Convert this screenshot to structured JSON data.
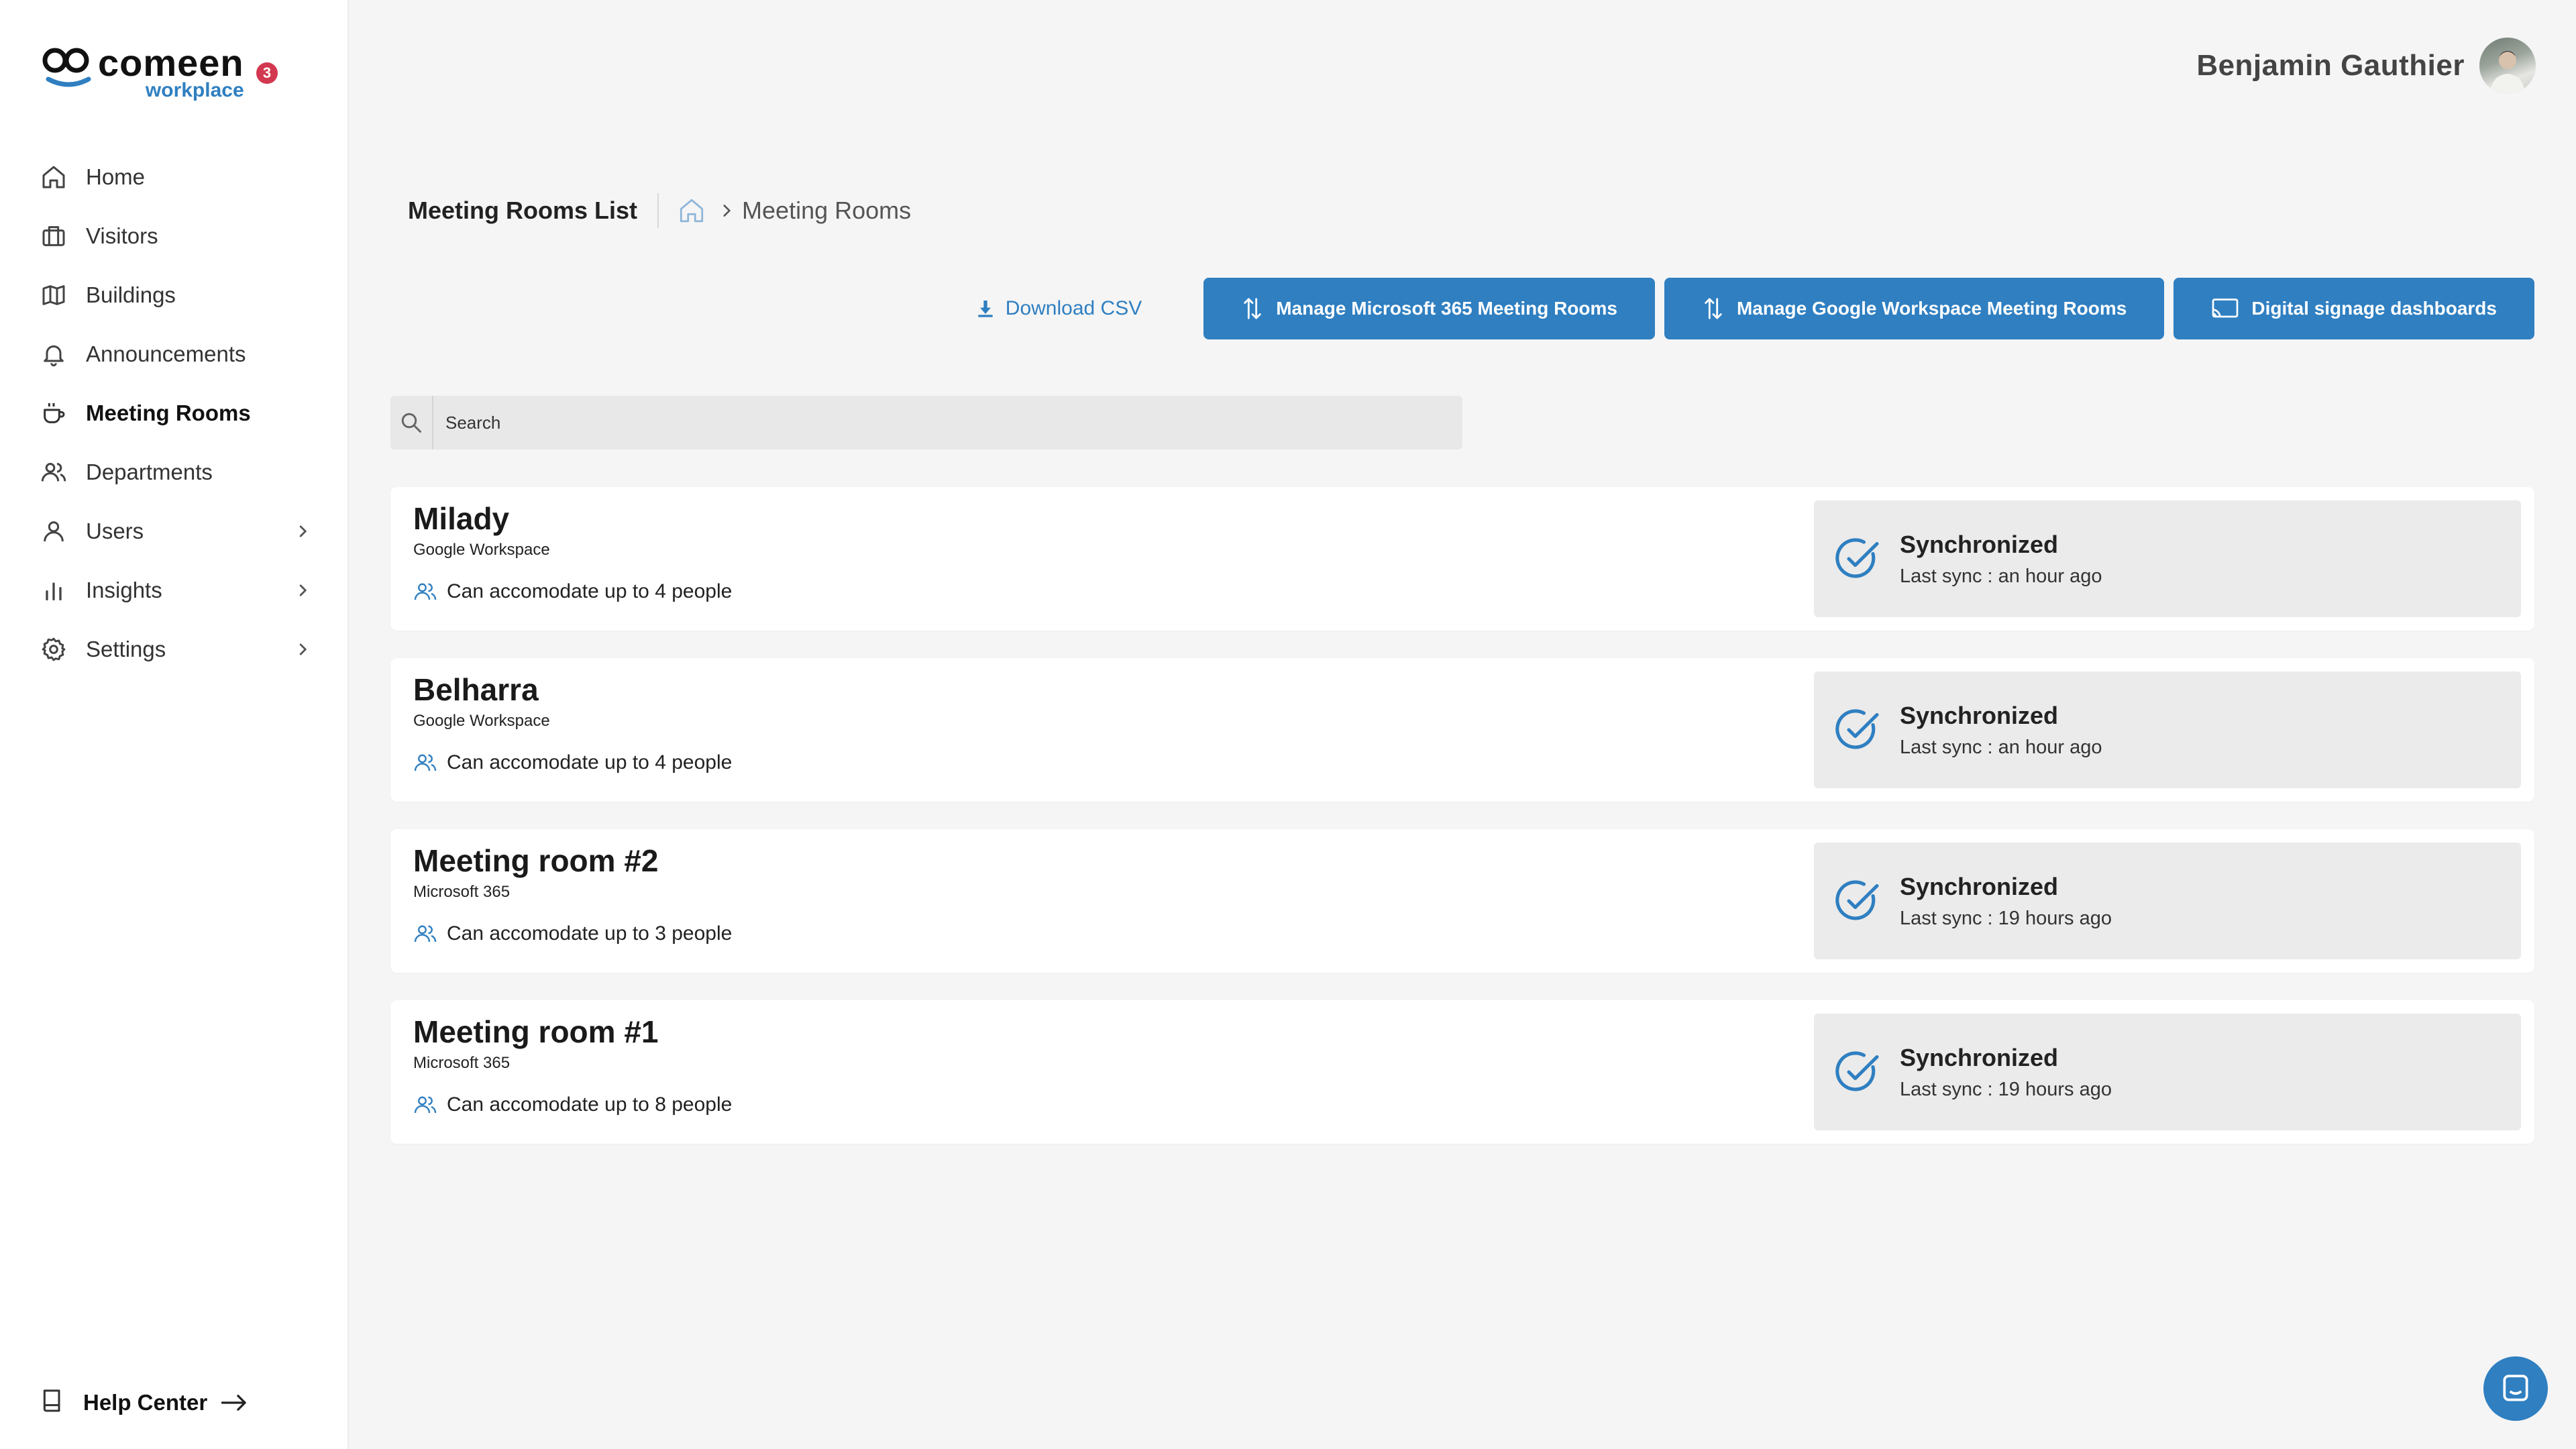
{
  "brand": {
    "name": "comeen",
    "subtitle": "workplace",
    "notification_count": "3",
    "accent": "#2f7fc1"
  },
  "sidebar": {
    "items": [
      {
        "label": "Home",
        "icon": "home-icon"
      },
      {
        "label": "Visitors",
        "icon": "briefcase-icon"
      },
      {
        "label": "Buildings",
        "icon": "map-icon"
      },
      {
        "label": "Announcements",
        "icon": "bell-icon"
      },
      {
        "label": "Meeting Rooms",
        "icon": "coffee-cup-icon",
        "active": true
      },
      {
        "label": "Departments",
        "icon": "users-icon"
      },
      {
        "label": "Users",
        "icon": "user-icon",
        "expandable": true
      },
      {
        "label": "Insights",
        "icon": "bar-chart-icon",
        "expandable": true
      },
      {
        "label": "Settings",
        "icon": "gear-icon",
        "expandable": true
      }
    ],
    "help_label": "Help Center"
  },
  "header": {
    "user_name": "Benjamin Gauthier"
  },
  "page": {
    "title": "Meeting Rooms List",
    "breadcrumb": "Meeting Rooms"
  },
  "actions": {
    "download_csv": "Download CSV",
    "manage_ms365": "Manage Microsoft 365 Meeting Rooms",
    "manage_google": "Manage Google Workspace Meeting Rooms",
    "digital_signage": "Digital signage dashboards"
  },
  "search": {
    "placeholder": "Search"
  },
  "rooms": [
    {
      "name": "Milady",
      "provider": "Google Workspace",
      "capacity": "Can accomodate up to 4 people",
      "status": "Synchronized",
      "last_sync": "Last sync : an hour ago"
    },
    {
      "name": "Belharra",
      "provider": "Google Workspace",
      "capacity": "Can accomodate up to 4 people",
      "status": "Synchronized",
      "last_sync": "Last sync : an hour ago"
    },
    {
      "name": "Meeting room #2",
      "provider": "Microsoft 365",
      "capacity": "Can accomodate up to 3 people",
      "status": "Synchronized",
      "last_sync": "Last sync : 19 hours ago"
    },
    {
      "name": "Meeting room #1",
      "provider": "Microsoft 365",
      "capacity": "Can accomodate up to 8 people",
      "status": "Synchronized",
      "last_sync": "Last sync : 19 hours ago"
    }
  ]
}
